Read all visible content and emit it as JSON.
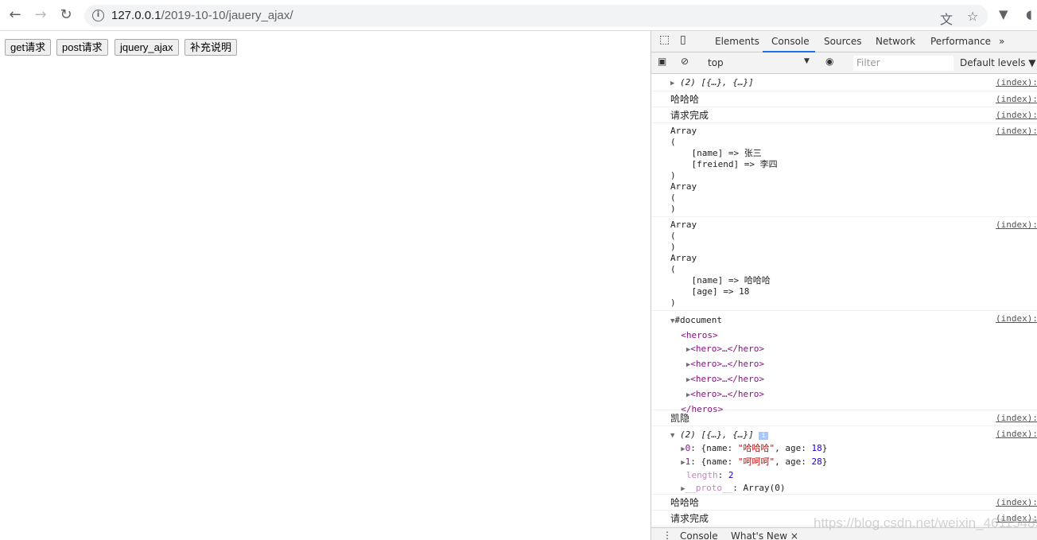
{
  "browser": {
    "url_host": "127.0.0.1",
    "url_path": "/2019-10-10/jauery_ajax/",
    "icons": [
      "back-arrow-icon",
      "forward-arrow-icon",
      "reload-icon",
      "info-icon",
      "translate-icon",
      "star-icon",
      "extension-icon"
    ]
  },
  "page": {
    "buttons": [
      "get请求",
      "post请求",
      "jquery_ajax",
      "补充说明"
    ]
  },
  "devtools": {
    "tabs": [
      "Elements",
      "Console",
      "Sources",
      "Network",
      "Performance",
      "»"
    ],
    "context": "top",
    "filter_placeholder": "Filter",
    "levels": "Default levels ▼",
    "source": "(index):",
    "entries": {
      "e1": "(2) [{…}, {…}]",
      "e2": "哈哈哈",
      "e3": "请求完成",
      "e4": "Array\n(\n    [name] => 张三\n    [freiend] => 李四\n)\nArray\n(\n)",
      "e5": "Array\n(\n)\nArray\n(\n    [name] => 哈哈哈\n    [age] => 18\n)",
      "e6": {
        "root": "#document",
        "open": "<heros>",
        "children": [
          "<hero>…</hero>",
          "<hero>…</hero>",
          "<hero>…</hero>",
          "<hero>…</hero>"
        ],
        "close": "</heros>"
      },
      "e7": "凯隐",
      "e8": {
        "summary": "(2) [{…}, {…}]",
        "i0": "0",
        "v0name": "\"哈哈哈\"",
        "v0age": "18",
        "i1": "1",
        "v1name": "\"呵呵呵\"",
        "v1age": "28",
        "length_key": "length",
        "length": "2",
        "proto_key": "__proto__",
        "proto": "Array(0)"
      },
      "e9": "哈哈哈",
      "e10": "请求完成"
    },
    "drawer_tabs": [
      "Console",
      "What's New ×"
    ]
  },
  "watermark": "https://blog.csdn.net/weixin_46115489"
}
